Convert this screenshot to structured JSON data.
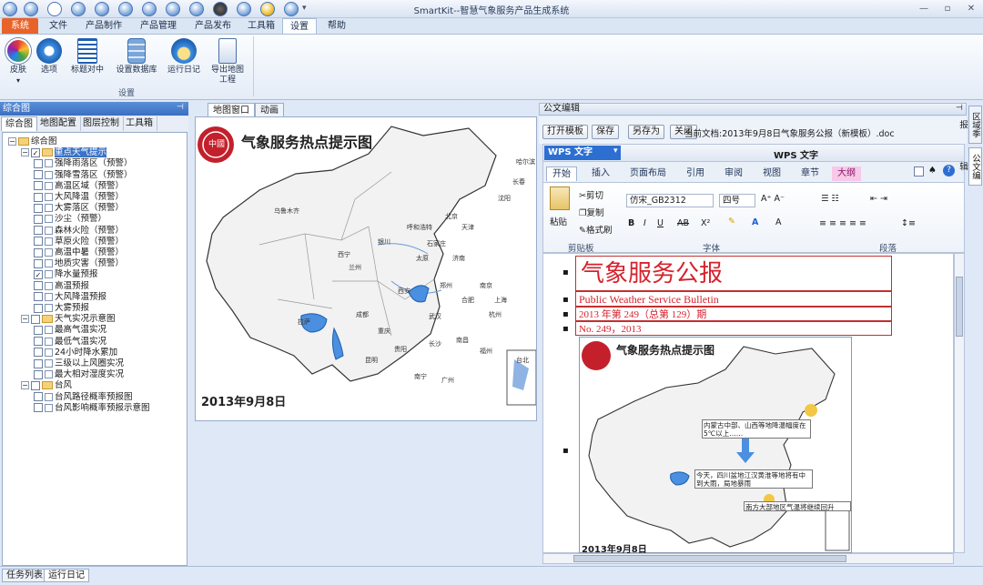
{
  "app_title": "SmartKit--智慧气象服务产品生成系统",
  "ribbon_tabs": [
    "系统",
    "文件",
    "产品制作",
    "产品管理",
    "产品发布",
    "工具箱",
    "设置",
    "帮助"
  ],
  "ribbon_buttons": [
    "皮肤",
    "选项",
    "标题对中",
    "设置数据库",
    "运行日记",
    "导出地图工程"
  ],
  "ribbon_group": "设置",
  "left_panel": {
    "title": "综合图",
    "tabs": [
      "综合图",
      "地图配置",
      "图层控制",
      "工具箱"
    ],
    "tree": {
      "root": "综合图",
      "g1": "重点天气提示",
      "g1_items": [
        "强降雨落区（预警）",
        "强降雪落区（预警）",
        "高温区域（预警）",
        "大风降温（预警）",
        "大雾落区（预警）",
        "沙尘（预警）",
        "森林火险（预警）",
        "草原火险（预警）",
        "高温中暑（预警）",
        "地质灾害（预警）",
        "降水量预报",
        "高温预报",
        "大风降温预报",
        "大雾预报"
      ],
      "g2": "天气实况示意图",
      "g2_items": [
        "最高气温实况",
        "最低气温实况",
        "24小时降水累加",
        "三级以上风圈实况",
        "最大相对湿度实况"
      ],
      "g3": "台风",
      "g3_items": [
        "台风路径概率预报图",
        "台风影响概率预报示意图"
      ]
    }
  },
  "middle": {
    "tabs": [
      "地图窗口",
      "动画"
    ],
    "map_title": "气象服务热点提示图",
    "map_date": "2013年9月8日",
    "seal": "中國",
    "map_labels": [
      "乌鲁木齐",
      "拉萨",
      "西宁",
      "兰州",
      "银川",
      "呼和浩特",
      "北京",
      "天津",
      "石家庄",
      "太原",
      "济南",
      "郑州",
      "西安",
      "成都",
      "重庆",
      "武汉",
      "合肥",
      "南京",
      "上海",
      "杭州",
      "长沙",
      "南昌",
      "贵阳",
      "昆明",
      "南宁",
      "广州",
      "福州",
      "台北",
      "沈阳",
      "长春",
      "哈尔滨"
    ]
  },
  "right": {
    "panel_title": "公文编辑",
    "buttons": [
      "打开模板",
      "保存",
      "另存为",
      "关闭"
    ],
    "current_doc_label": "当前文档:2013年9月8日气象服务公报（新模板）.doc",
    "wps_logo": "WPS 文字",
    "wps_title": "WPS 文字",
    "wps_tabs": [
      "开始",
      "插入",
      "页面布局",
      "引用",
      "审阅",
      "视图",
      "章节",
      "大纲"
    ],
    "clipboard": {
      "paste": "粘贴",
      "cut": "剪切",
      "copy": "复制",
      "format": "格式刷",
      "group": "剪贴板"
    },
    "font": {
      "name": "仿宋_GB2312",
      "size": "四号",
      "group": "字体"
    },
    "para_group": "段落",
    "bulletin": {
      "title": "气象服务公报",
      "en": "Public Weather Service Bulletin",
      "issue": "2013 年第 249（总第 129）期",
      "no": "No. 249，2013"
    },
    "doc_map": {
      "title": "气象服务热点提示图",
      "date": "2013年9月8日",
      "notes": [
        "内蒙古中部、山西等地降温幅度在5℃以上……",
        "今天，四川盆地江汉黄淮等地将有中到大雨，局地暴雨",
        "南方大部地区气温将继续回升"
      ]
    },
    "side_tabs": [
      "区域季报",
      "公文编辑"
    ]
  },
  "bottom_tabs": [
    "任务列表",
    "运行日记"
  ]
}
